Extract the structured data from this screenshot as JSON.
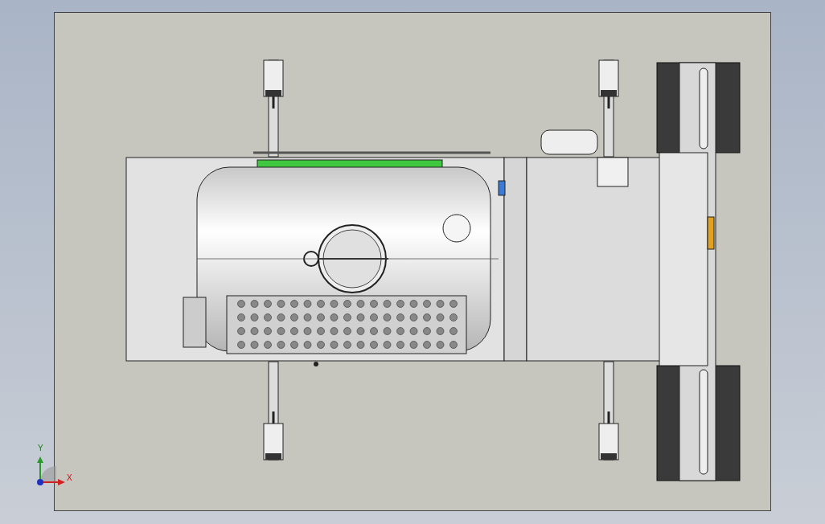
{
  "triad": {
    "y_label": "Y",
    "x_label": "X"
  }
}
